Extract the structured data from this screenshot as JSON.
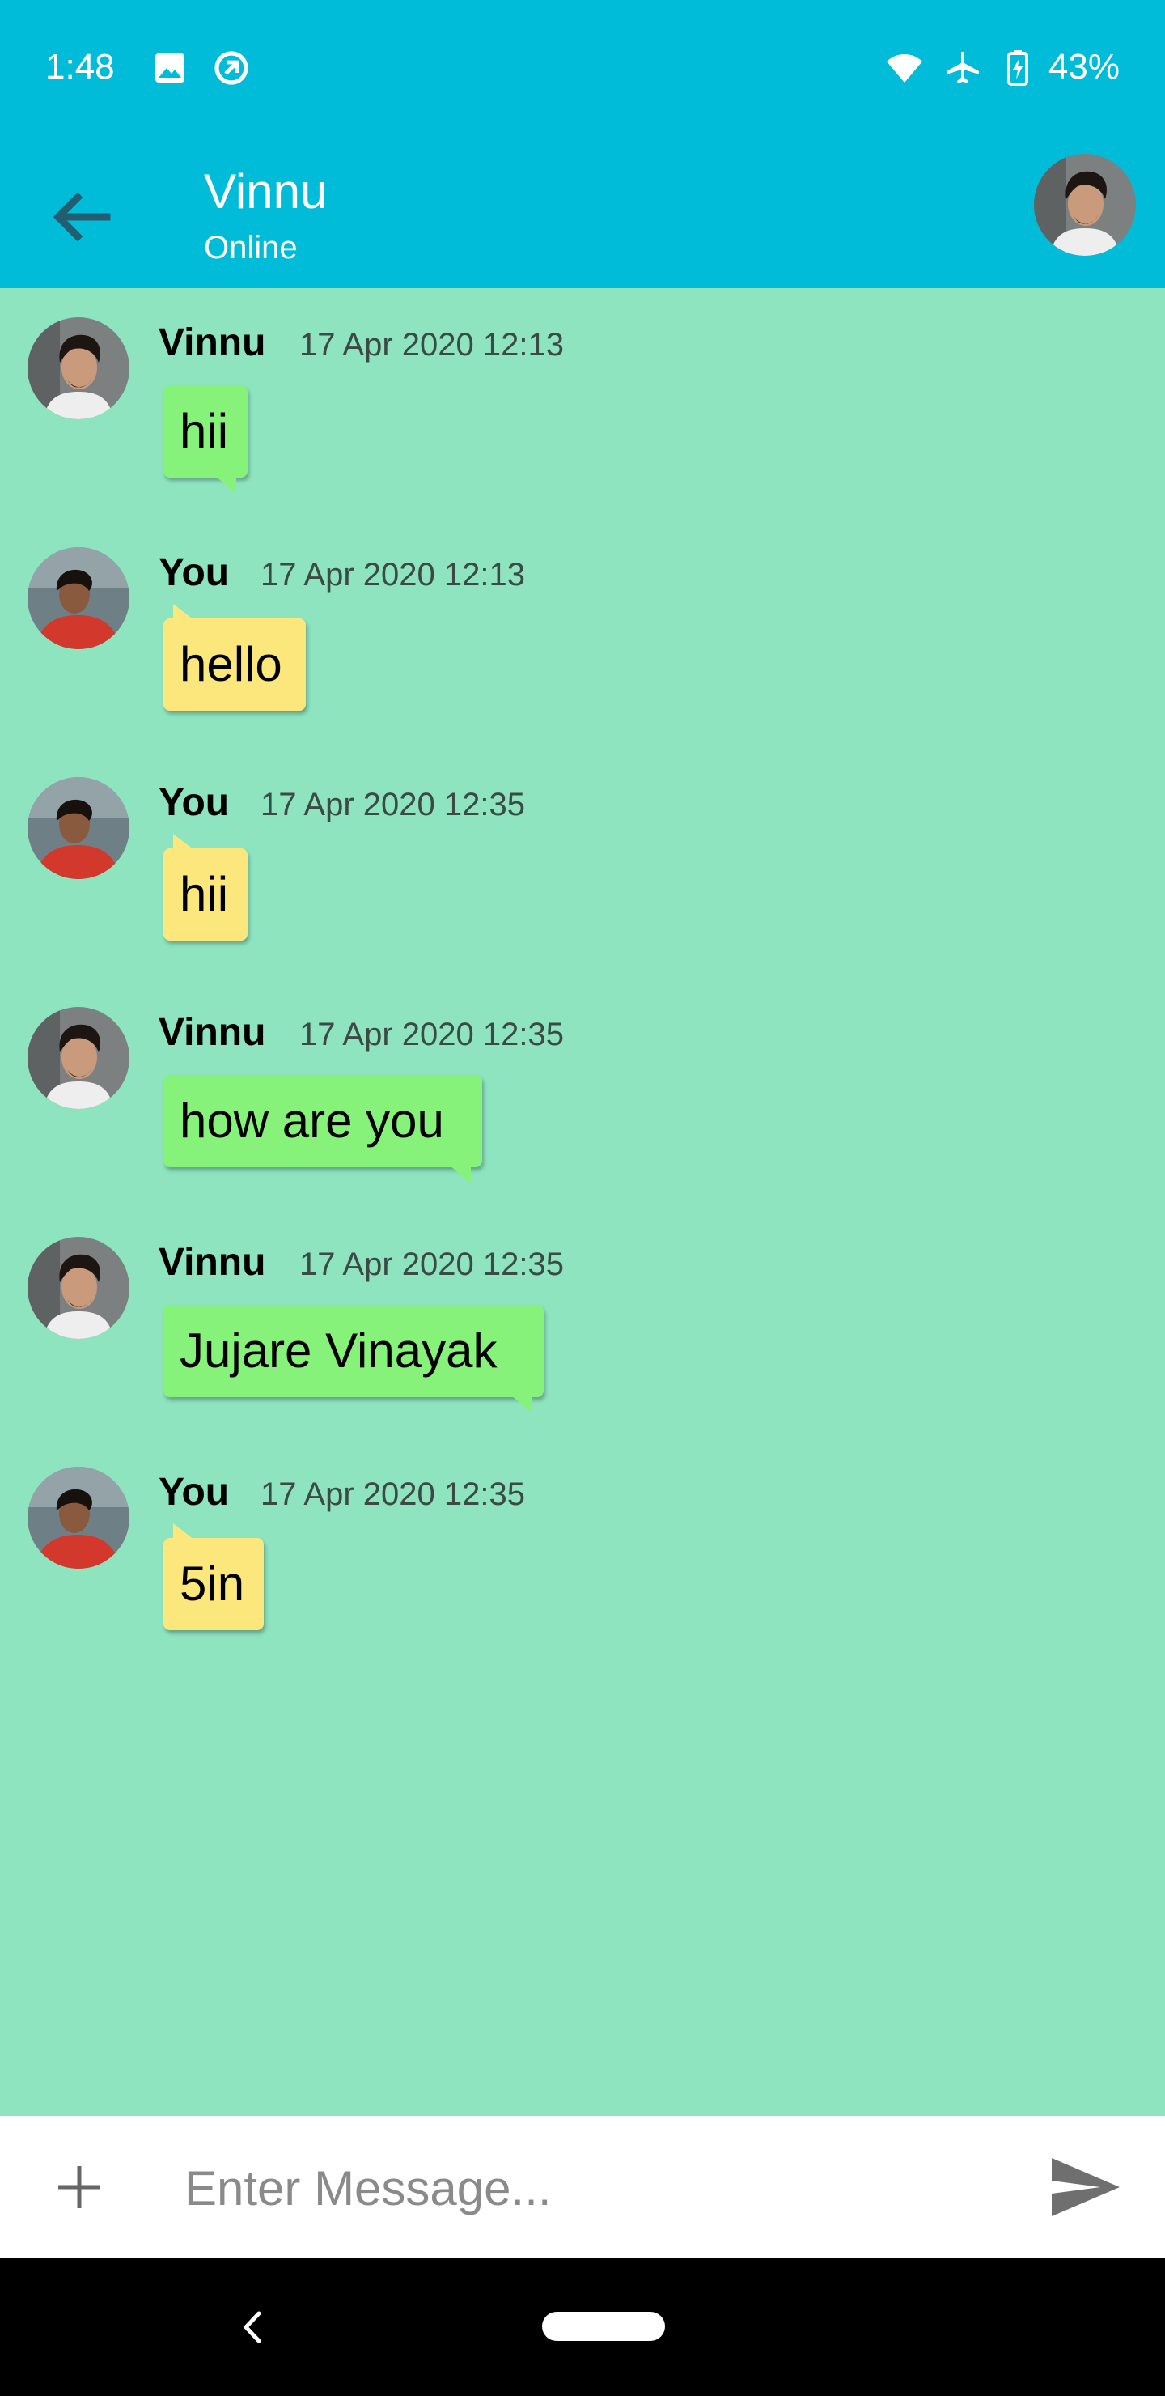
{
  "status_bar": {
    "time": "1:48",
    "battery_pct": "43%",
    "icons": [
      "image-icon",
      "sync-icon",
      "wifi-icon",
      "airplane-icon",
      "battery-charging-icon"
    ]
  },
  "header": {
    "title": "Vinnu",
    "subtitle": "Online",
    "back_icon": "arrow-back-icon"
  },
  "messages": [
    {
      "sender": "Vinnu",
      "time": "17 Apr 2020 12:13",
      "text": "hii",
      "direction": "incoming"
    },
    {
      "sender": "You",
      "time": "17 Apr 2020 12:13",
      "text": "hello",
      "direction": "outgoing"
    },
    {
      "sender": "You",
      "time": "17 Apr 2020 12:35",
      "text": "hii",
      "direction": "outgoing"
    },
    {
      "sender": "Vinnu",
      "time": "17 Apr 2020 12:35",
      "text": "how are you",
      "direction": "incoming"
    },
    {
      "sender": "Vinnu",
      "time": "17 Apr 2020 12:35",
      "text": "Jujare Vinayak",
      "direction": "incoming"
    },
    {
      "sender": "You",
      "time": "17 Apr 2020 12:35",
      "text": "5in",
      "direction": "outgoing"
    }
  ],
  "composer": {
    "placeholder": "Enter Message...",
    "value": "",
    "add_icon": "plus-icon",
    "send_icon": "send-icon"
  },
  "colors": {
    "header": "#00bcd9",
    "chat_background": "#8de4bf",
    "incoming_bubble": "#86f27a",
    "outgoing_bubble": "#fbe77c"
  }
}
